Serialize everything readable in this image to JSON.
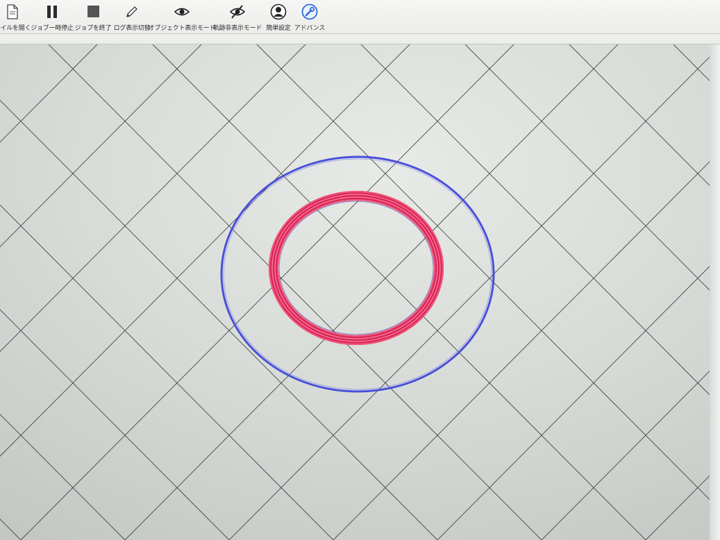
{
  "toolbar": {
    "items": [
      {
        "label": "ァイルを開く",
        "icon": "file-icon"
      },
      {
        "label": "ジョブ一時停止",
        "icon": "pause-icon"
      },
      {
        "label": "ジョブを終了",
        "icon": "stop-icon"
      },
      {
        "label": "ログ表示切替",
        "icon": "pencil-icon"
      },
      {
        "label": "オブジェクト表示モード",
        "icon": "eye-icon"
      },
      {
        "label": "軌跡非表示モード",
        "icon": "eye-slash-icon"
      },
      {
        "label": "簡単設定",
        "icon": "user-settings-icon"
      },
      {
        "label": "アドバンス",
        "icon": "wrench-icon"
      }
    ]
  },
  "viewport": {
    "grid_color": "#2a2d2c",
    "outer_ring_color": "#4a4fd8",
    "inner_ring_color": "#e8345e"
  }
}
